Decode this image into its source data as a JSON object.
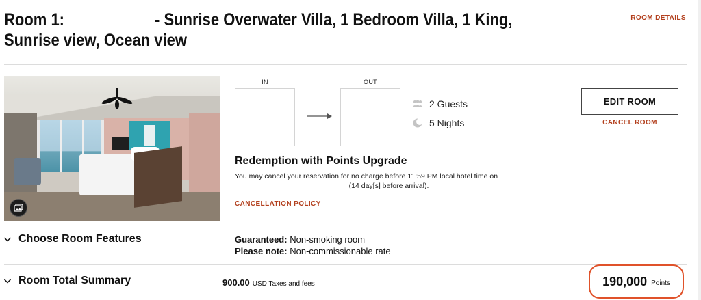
{
  "room": {
    "title_prefix": "Room 1:",
    "title_main": "- Sunrise Overwater Villa, 1 Bedroom Villa, 1 King,",
    "title_line2": "Sunrise view, Ocean view",
    "details_link": "ROOM DETAILS"
  },
  "dates": {
    "in_label": "IN",
    "out_label": "OUT"
  },
  "stay": {
    "guests": "2 Guests",
    "nights": "5 Nights"
  },
  "actions": {
    "edit_room": "EDIT ROOM",
    "cancel_room": "CANCEL ROOM"
  },
  "rate": {
    "title": "Redemption with Points Upgrade",
    "cancel_line1": "You may cancel your reservation for no charge before 11:59 PM local hotel time on",
    "cancel_line2": "(14 day[s] before arrival).",
    "policy_link": "CANCELLATION POLICY"
  },
  "features": {
    "toggle_label": "Choose Room Features",
    "guaranteed_label": "Guaranteed:",
    "guaranteed_value": "Non-smoking room",
    "note_label": "Please note:",
    "note_value": "Non-commissionable rate"
  },
  "summary": {
    "toggle_label": "Room Total Summary",
    "taxes_amount": "900.00",
    "taxes_label": "USD Taxes and fees",
    "points_amount": "190,000",
    "points_unit": "Points"
  },
  "colors": {
    "accent": "#b3401e",
    "highlight_oval": "#e0522a"
  },
  "icons": {
    "guests": "guests-icon",
    "nights": "moon-icon",
    "arrow": "arrow-right-icon",
    "gallery": "gallery-icon",
    "chevron": "chevron-down-icon"
  }
}
